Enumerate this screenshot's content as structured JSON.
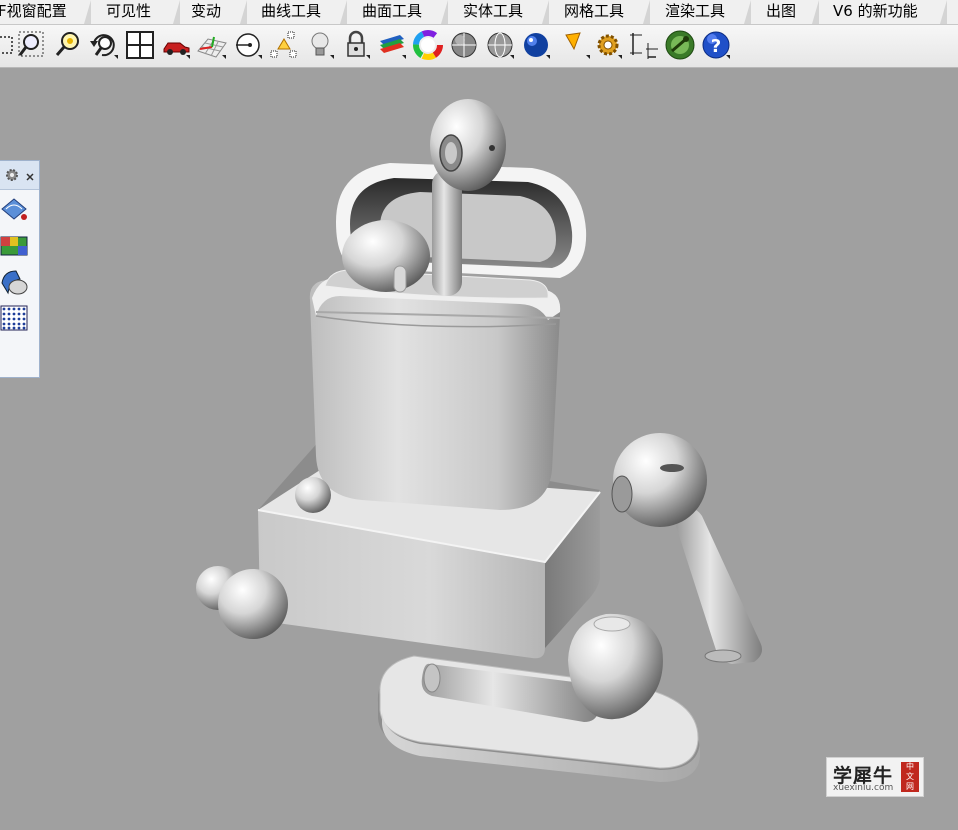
{
  "menu_tabs": [
    "F视窗配置",
    "可见性",
    "变动",
    "曲线工具",
    "曲面工具",
    "实体工具",
    "网格工具",
    "渲染工具",
    "出图",
    "V6 的新功能"
  ],
  "toolbar_icons": [
    "select-window-icon",
    "zoom-window-icon",
    "zoom-selected-icon",
    "rotate-view-icon",
    "four-viewports-icon",
    "car-named-view-icon",
    "construction-plane-grid-icon",
    "point-snap-icon",
    "object-snap-icon",
    "light-bulb-icon",
    "lock-icon",
    "layer-book-icon",
    "color-wheel-icon",
    "shaded-sphere-icon",
    "wireframe-sphere-icon",
    "rendered-blue-sphere-icon",
    "material-cone-icon",
    "settings-gear-icon",
    "dimension-icon",
    "grasshopper-icon",
    "help-icon"
  ],
  "side_panel": {
    "icons": [
      "panel-settings-icon",
      "panel-close-icon",
      "surface-analysis-icon",
      "texture-map-icon",
      "draft-angle-icon",
      "point-grid-icon"
    ]
  },
  "scene": {
    "description": "",
    "background_color": "#a0a0a0"
  },
  "watermark": {
    "main": "学犀牛",
    "sub": "xuexiniu.com",
    "seal": [
      "中",
      "文",
      "网"
    ]
  }
}
